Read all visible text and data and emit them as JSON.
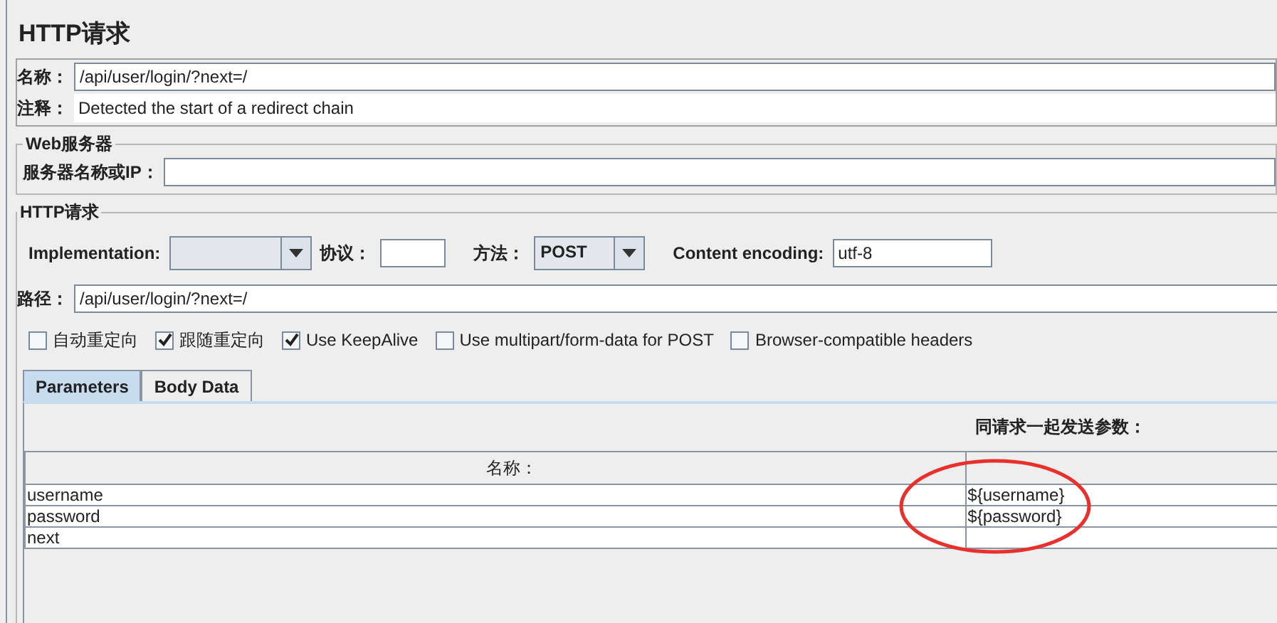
{
  "title": "HTTP请求",
  "name_field": {
    "label": "名称：",
    "value": "/api/user/login/?next=/"
  },
  "comment_field": {
    "label": "注释：",
    "value": "Detected the start of a redirect chain"
  },
  "web_server": {
    "legend": "Web服务器",
    "label": "服务器名称或IP："
  },
  "http_request": {
    "legend": "HTTP请求",
    "implementation": {
      "label": "Implementation:"
    },
    "protocol": {
      "label": "协议："
    },
    "method": {
      "label": "方法：",
      "value": "POST"
    },
    "encoding": {
      "label": "Content encoding:",
      "value": "utf-8"
    },
    "path": {
      "label": "路径：",
      "value": "/api/user/login/?next=/"
    }
  },
  "options": [
    {
      "label": "自动重定向",
      "checked": false
    },
    {
      "label": "跟随重定向",
      "checked": true
    },
    {
      "label": "Use KeepAlive",
      "checked": true
    },
    {
      "label": "Use multipart/form-data for POST",
      "checked": false
    },
    {
      "label": "Browser-compatible headers",
      "checked": false
    }
  ],
  "tabs": [
    {
      "label": "Parameters",
      "selected": true
    },
    {
      "label": "Body Data",
      "selected": false
    }
  ],
  "parameters": {
    "caption": "同请求一起发送参数：",
    "columns": [
      "名称："
    ],
    "rows": [
      {
        "name": "username",
        "value": "${username}"
      },
      {
        "name": "password",
        "value": "${password}"
      },
      {
        "name": "next"
      }
    ],
    "annotation": {
      "kind": "ellipse"
    }
  }
}
